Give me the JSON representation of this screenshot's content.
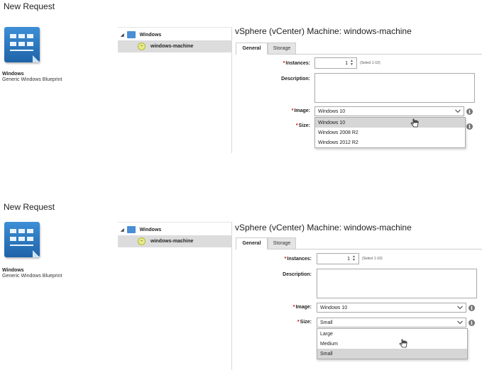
{
  "panels": [
    {
      "page_title": "New Request",
      "blueprint": {
        "icon": "windows-blueprint-icon",
        "name": "Windows",
        "description": "Generic Windows Blueprint"
      },
      "tree": {
        "root": "Windows",
        "child": "windows-machine"
      },
      "machine_title": "vSphere (vCenter) Machine: windows-machine",
      "tabs": [
        "General",
        "Storage"
      ],
      "form": {
        "instances_label": "Instances:",
        "instances_value": "1",
        "instances_hint": "(Select 1-10)",
        "description_label": "Description:",
        "image_label": "Image:",
        "image_value": "Windows 10",
        "size_label": "Size:",
        "size_value": ""
      },
      "dropdown": {
        "for": "image",
        "options": [
          "Windows 10",
          "Windows 2008 R2",
          "Windows 2012 R2"
        ],
        "highlighted": "Windows 10"
      }
    },
    {
      "page_title": "New Request",
      "blueprint": {
        "icon": "windows-blueprint-icon",
        "name": "Windows",
        "description": "Generic Windows Blueprint"
      },
      "tree": {
        "root": "Windows",
        "child": "windows-machine"
      },
      "machine_title": "vSphere (vCenter) Machine: windows-machine",
      "tabs": [
        "General",
        "Storage"
      ],
      "form": {
        "instances_label": "Instances:",
        "instances_value": "1",
        "instances_hint": "(Select 1-10)",
        "description_label": "Description:",
        "image_label": "Image:",
        "image_value": "Windows 10",
        "size_label": "Size:",
        "size_value": "Small"
      },
      "dropdown": {
        "for": "size",
        "options": [
          "Large",
          "Medium",
          "Small"
        ],
        "highlighted": "Small"
      }
    }
  ],
  "colors": {
    "accent": "#2f7fd1",
    "required": "#dd0000",
    "selected_row": "#dcdcdc",
    "highlight": "#d6d6d6"
  }
}
